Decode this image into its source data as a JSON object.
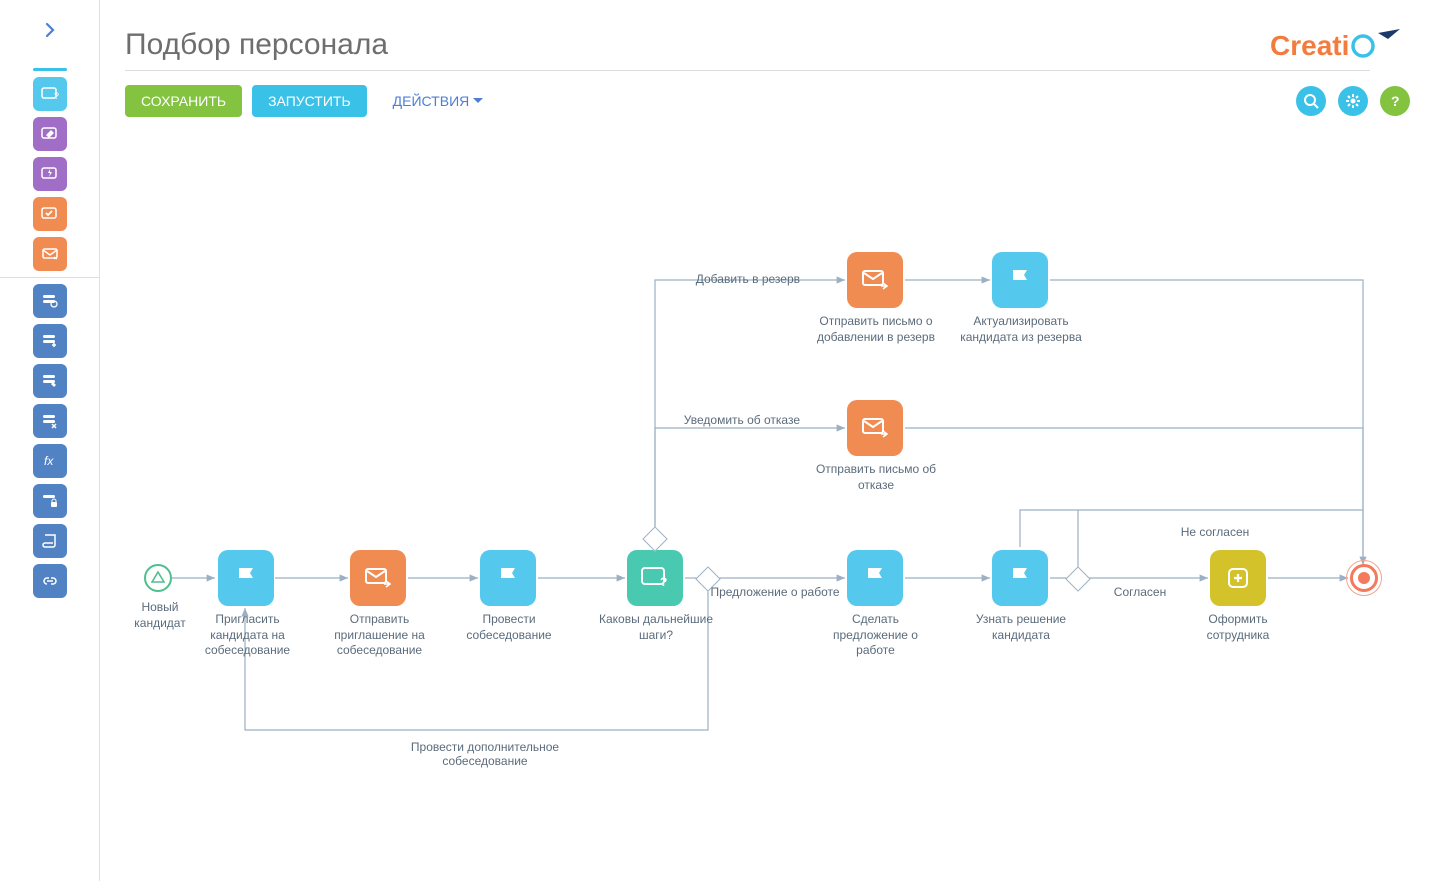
{
  "header": {
    "title": "Подбор персонала",
    "logo": "Creatio"
  },
  "toolbar": {
    "save_label": "СОХРАНИТЬ",
    "run_label": "ЗАПУСТИТЬ",
    "actions_label": "ДЕЙСТВИЯ"
  },
  "colors": {
    "green": "#83c340",
    "blue": "#3ac1e8",
    "orange": "#f08b52",
    "teal": "#48c9b0",
    "yellow": "#d4c22a",
    "violet": "#a06dc7",
    "darkblue": "#5082c4"
  },
  "nodes": {
    "start": {
      "label": "Новый кандидат"
    },
    "invite": {
      "label": "Пригласить кандидата на собеседование",
      "type": "flag",
      "color": "blue"
    },
    "send_invite": {
      "label": "Отправить приглашение на собеседование",
      "type": "email",
      "color": "orange"
    },
    "interview": {
      "label": "Провести собеседование",
      "type": "flag",
      "color": "blue"
    },
    "next_steps": {
      "label": "Каковы дальнейшие шаги?",
      "type": "dialog",
      "color": "teal"
    },
    "make_offer": {
      "label": "Сделать предложение о работе",
      "type": "flag",
      "color": "blue"
    },
    "decision": {
      "label": "Узнать решение кандидата",
      "type": "flag",
      "color": "blue"
    },
    "hire": {
      "label": "Оформить сотрудника",
      "type": "plus",
      "color": "yellow"
    },
    "reserve_mail": {
      "label": "Отправить письмо о добавлении в резерв",
      "type": "email",
      "color": "orange"
    },
    "actualize": {
      "label": "Актуализировать кандидата из резерва",
      "type": "flag",
      "color": "blue"
    },
    "reject_mail": {
      "label": "Отправить письмо об отказе",
      "type": "email",
      "color": "orange"
    }
  },
  "edges": {
    "to_reserve": "Добавить в резерв",
    "notify_reject": "Уведомить об отказе",
    "job_offer": "Предложение о работе",
    "agreed": "Согласен",
    "disagreed": "Не согласен",
    "extra_interview": "Провести дополнительное собеседование"
  }
}
